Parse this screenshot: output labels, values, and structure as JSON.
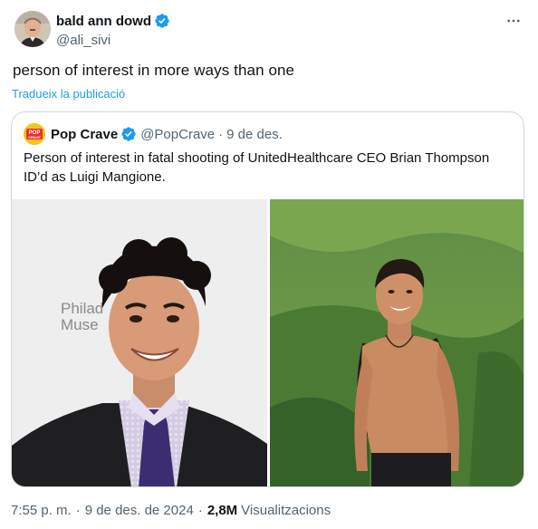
{
  "author": {
    "display_name": "bald ann dowd",
    "handle": "@ali_sivi",
    "verified": true
  },
  "tweet": {
    "text": "person of interest in more ways than one",
    "translate_label": "Tradueix la publicació"
  },
  "quote": {
    "display_name": "Pop Crave",
    "avatar_text_top": "POP",
    "avatar_text_bottom": "CRAVE",
    "handle": "@PopCrave",
    "separator": "·",
    "date": "9 de des.",
    "text": "Person of interest in fatal shooting of UnitedHealthcare CEO Brian Thompson ID’d as Luigi Mangione.",
    "photo_1": {
      "sign_line_1": "Philad",
      "sign_line_2": "Muse"
    }
  },
  "meta": {
    "time": "7:55 p. m.",
    "separator": "·",
    "date": "9 de des. de 2024",
    "views_count": "2,8M",
    "views_label": "Visualitzacions"
  },
  "colors": {
    "verified_blue": "#1d9bf0",
    "link_blue": "#1d9bf0",
    "secondary_text": "#536471",
    "border": "#cfd9de",
    "popcrave_yellow": "#f5c518"
  },
  "icons": {
    "verified": "verified-badge-icon",
    "more": "more-horizontal-icon"
  }
}
